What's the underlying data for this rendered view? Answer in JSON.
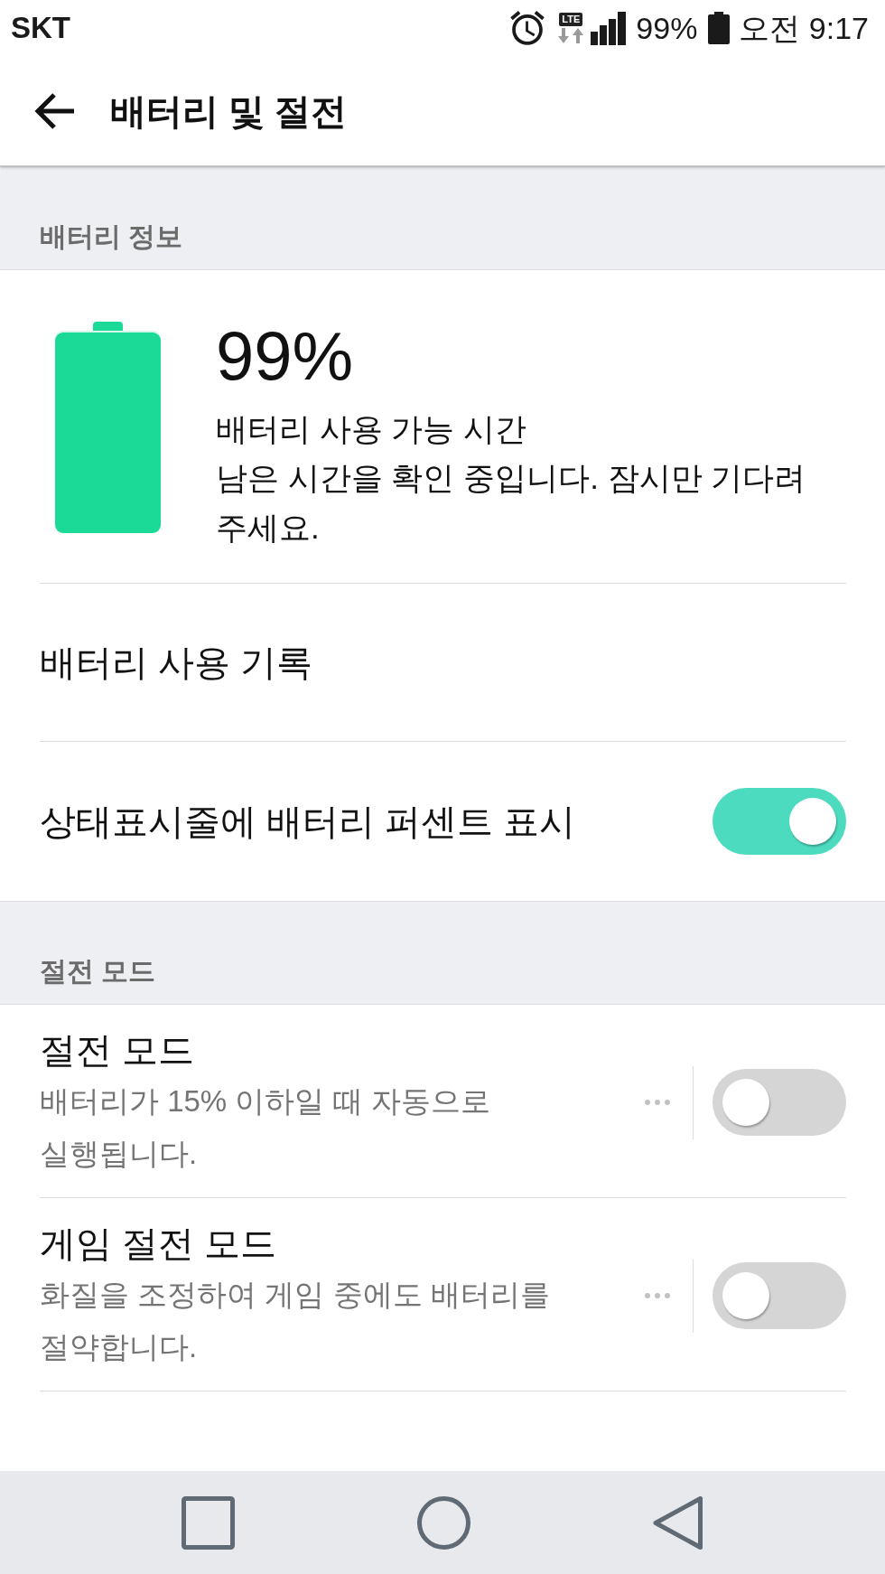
{
  "status_bar": {
    "carrier": "SKT",
    "network": "LTE",
    "battery": "99%",
    "time": "오전 9:17"
  },
  "app_bar": {
    "title": "배터리 및 절전"
  },
  "sections": [
    {
      "header": "배터리 정보",
      "items": [
        {
          "kind": "battery",
          "percent": "99%",
          "level": 0.99,
          "label": "배터리 사용 가능 시간",
          "description": "남은 시간을 확인 중입니다. 잠시만 기다려 주세요."
        },
        {
          "kind": "link",
          "title": "배터리 사용 기록"
        },
        {
          "kind": "switch",
          "title": "상태표시줄에 배터리 퍼센트 표시",
          "on": true,
          "more_button": false
        }
      ]
    },
    {
      "header": "절전 모드",
      "items": [
        {
          "kind": "switch",
          "title": "절전 모드",
          "subtitle": "배터리가 15% 이하일 때 자동으로 실행됩니다.",
          "on": false,
          "more_button": true
        },
        {
          "kind": "switch",
          "title": "게임 절전 모드",
          "subtitle": "화질을 조정하여 게임 중에도 배터리를 절약합니다.",
          "on": false,
          "more_button": true
        }
      ]
    }
  ]
}
